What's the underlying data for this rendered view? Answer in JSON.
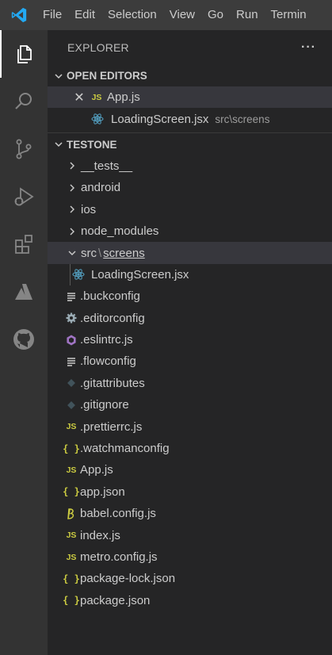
{
  "menu": [
    "File",
    "Edit",
    "Selection",
    "View",
    "Go",
    "Run",
    "Termin"
  ],
  "sidebar": {
    "title": "EXPLORER",
    "more": "···"
  },
  "open_editors": {
    "title": "OPEN EDITORS",
    "items": [
      {
        "name": "App.js",
        "icon": "js-icon",
        "close": "✕"
      },
      {
        "name": "LoadingScreen.jsx",
        "icon": "react-icon",
        "description": "src\\screens"
      }
    ]
  },
  "workspace": {
    "title": "TESTONE",
    "folders": [
      "__tests__",
      "android",
      "ios",
      "node_modules"
    ],
    "compact_folder": {
      "part1": "src",
      "separator": "\\",
      "part2": "screens"
    },
    "nested_file": "LoadingScreen.jsx",
    "files": [
      {
        "name": ".buckconfig",
        "icon": "lines-icon"
      },
      {
        "name": ".editorconfig",
        "icon": "gear-icon"
      },
      {
        "name": ".eslintrc.js",
        "icon": "eslint-icon"
      },
      {
        "name": ".flowconfig",
        "icon": "lines-icon"
      },
      {
        "name": ".gitattributes",
        "icon": "git-icon"
      },
      {
        "name": ".gitignore",
        "icon": "git-icon"
      },
      {
        "name": ".prettierrc.js",
        "icon": "js-icon"
      },
      {
        "name": ".watchmanconfig",
        "icon": "json-icon"
      },
      {
        "name": "App.js",
        "icon": "js-icon"
      },
      {
        "name": "app.json",
        "icon": "json-icon"
      },
      {
        "name": "babel.config.js",
        "icon": "babel-icon"
      },
      {
        "name": "index.js",
        "icon": "js-icon"
      },
      {
        "name": "metro.config.js",
        "icon": "js-icon"
      },
      {
        "name": "package-lock.json",
        "icon": "json-icon"
      },
      {
        "name": "package.json",
        "icon": "json-icon"
      }
    ]
  },
  "badges": {
    "js": "JS",
    "json": "{ }"
  },
  "colors": {
    "accent": "#007acc",
    "js": "#cbcb41",
    "react": "#519aba",
    "eslint": "#a074c4",
    "git": "#41535b"
  }
}
